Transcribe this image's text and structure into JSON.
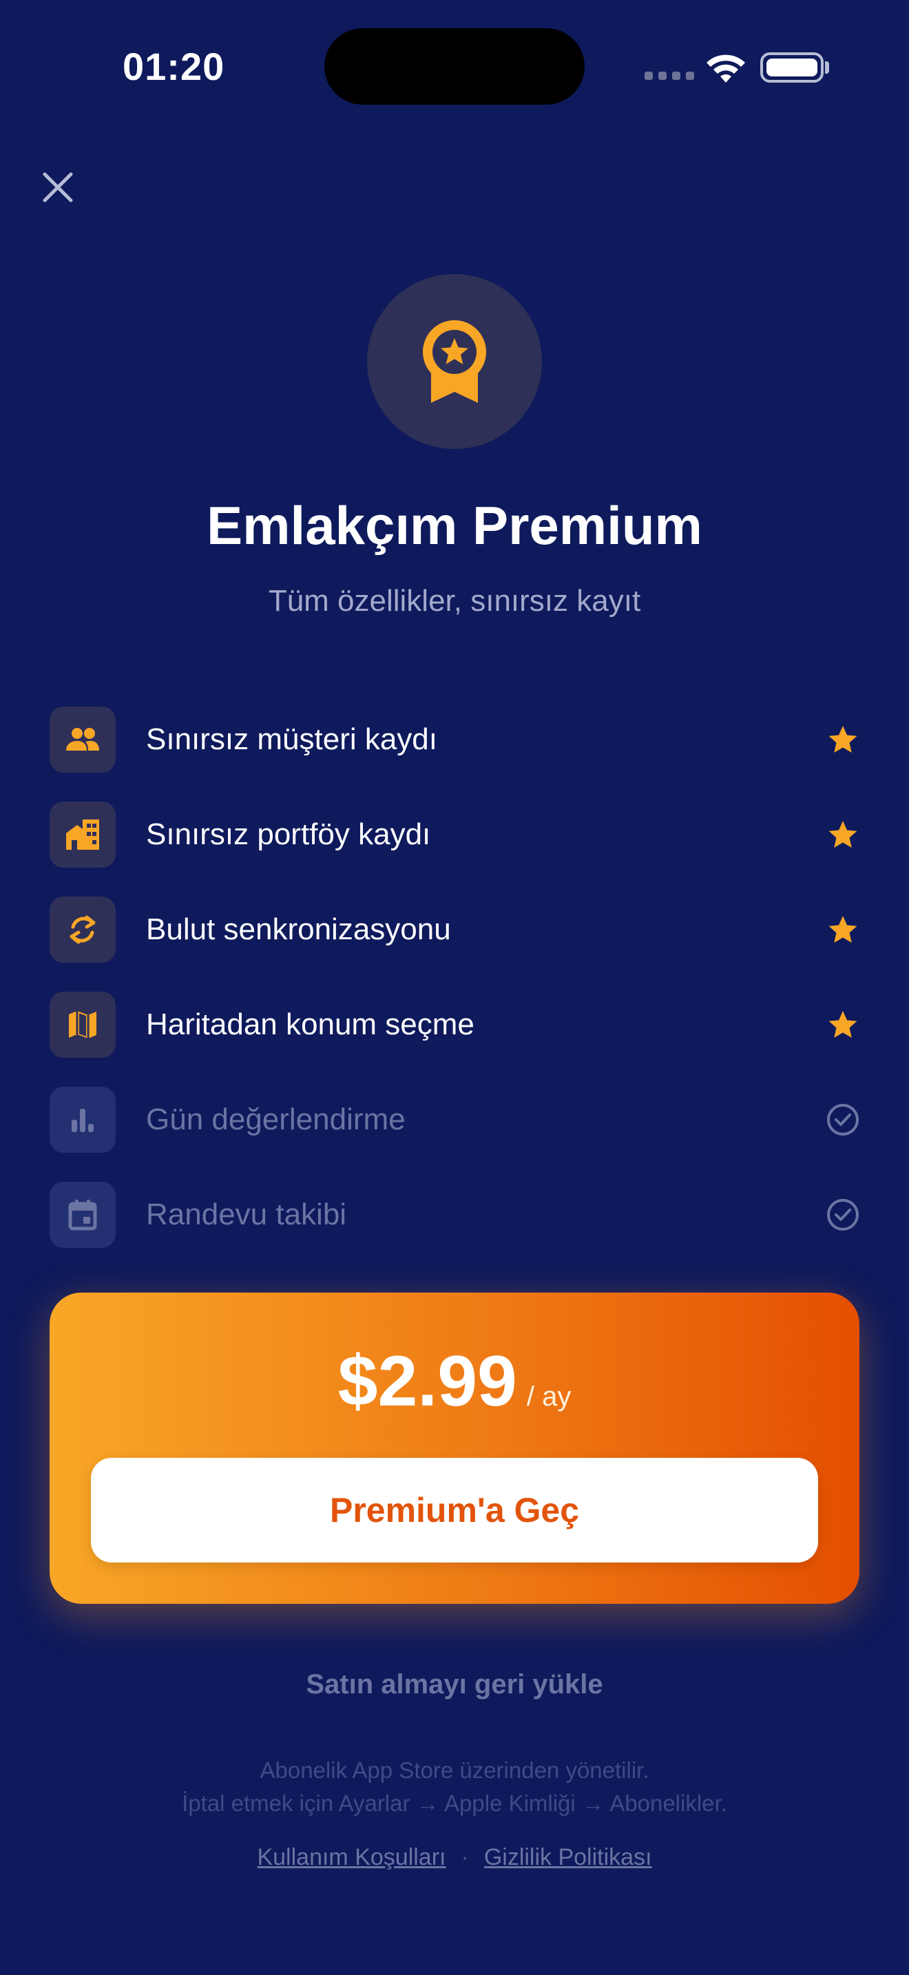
{
  "status_bar": {
    "time": "01:20"
  },
  "header": {
    "close_icon": "close-icon"
  },
  "hero": {
    "badge_icon": "award-medal-icon",
    "title": "Emlakçım Premium",
    "subtitle": "Tüm özellikler, sınırsız kayıt"
  },
  "features": [
    {
      "label": "Sınırsız müşteri kaydı",
      "icon": "people-icon",
      "mark": "star-icon",
      "premium": true
    },
    {
      "label": "Sınırsız portföy kaydı",
      "icon": "buildings-icon",
      "mark": "star-icon",
      "premium": true
    },
    {
      "label": "Bulut senkronizasyonu",
      "icon": "sync-icon",
      "mark": "star-icon",
      "premium": true
    },
    {
      "label": "Haritadan konum seçme",
      "icon": "map-icon",
      "mark": "star-icon",
      "premium": true
    },
    {
      "label": "Gün değerlendirme",
      "icon": "bar-chart-icon",
      "mark": "check-circle-icon",
      "premium": false
    },
    {
      "label": "Randevu takibi",
      "icon": "calendar-icon",
      "mark": "check-circle-icon",
      "premium": false
    }
  ],
  "pricing": {
    "amount": "$2.99",
    "period": "/ ay",
    "cta_label": "Premium'a Geç"
  },
  "restore_label": "Satın almayı geri yükle",
  "footnote": {
    "line1": "Abonelik App Store üzerinden yönetilir.",
    "line2": "İptal etmek için Ayarlar → Apple Kimliği → Abonelikler."
  },
  "links": {
    "terms": "Kullanım Koşulları",
    "separator": "·",
    "privacy": "Gizlilik Politikası"
  },
  "colors": {
    "background": "#0e1a5c",
    "accent": "#f8a626",
    "accent_dark": "#e44f00",
    "muted": "#6b74a3"
  }
}
